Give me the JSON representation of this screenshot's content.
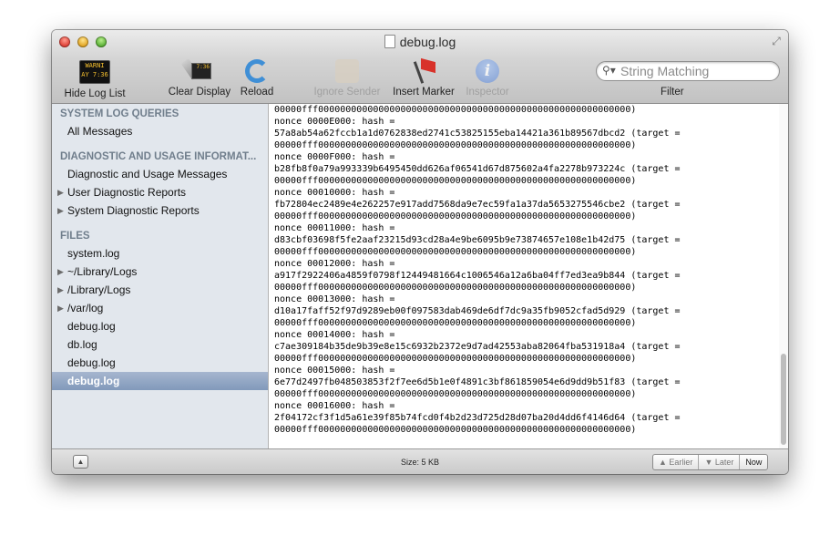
{
  "window": {
    "title": "debug.log"
  },
  "toolbar": {
    "hide_log_list": {
      "label": "Hide Log List",
      "icon": "console-icon",
      "screen_text": "WARNI\nAY 7:36"
    },
    "clear_display": {
      "label": "Clear Display",
      "icon": "clear-display-icon",
      "screen_text": "7:36"
    },
    "reload": {
      "label": "Reload",
      "icon": "reload-icon"
    },
    "ignore_sender": {
      "label": "Ignore Sender",
      "icon": "ignore-sender-icon",
      "enabled": false
    },
    "insert_marker": {
      "label": "Insert Marker",
      "icon": "flag-icon"
    },
    "inspector": {
      "label": "Inspector",
      "icon": "info-icon",
      "glyph": "i",
      "enabled": false
    }
  },
  "search": {
    "placeholder": "String Matching",
    "value": "",
    "label": "Filter"
  },
  "sidebar": {
    "sections": [
      {
        "heading": "SYSTEM LOG QUERIES",
        "items": [
          {
            "label": "All Messages"
          }
        ]
      },
      {
        "heading": "DIAGNOSTIC AND USAGE INFORMAT...",
        "items": [
          {
            "label": "Diagnostic and Usage Messages"
          },
          {
            "label": "User Diagnostic Reports",
            "disclosure": true
          },
          {
            "label": "System Diagnostic Reports",
            "disclosure": true
          }
        ]
      },
      {
        "heading": "FILES",
        "items": [
          {
            "label": "system.log"
          },
          {
            "label": "~/Library/Logs",
            "disclosure": true
          },
          {
            "label": "/Library/Logs",
            "disclosure": true
          },
          {
            "label": "/var/log",
            "disclosure": true
          },
          {
            "label": "debug.log"
          },
          {
            "label": "db.log"
          },
          {
            "label": "debug.log"
          },
          {
            "label": "debug.log",
            "selected": true
          }
        ]
      }
    ]
  },
  "log_text": "00000fff000000000000000000000000000000000000000000000000000000000)\nnonce 0000E000: hash =\n57a8ab54a62fccb1a1d0762838ed2741c53825155eba14421a361b89567dbcd2 (target =\n00000fff000000000000000000000000000000000000000000000000000000000)\nnonce 0000F000: hash =\nb28fb8f0a79a993339b6495450dd626af06541d67d875602a4fa2278b973224c (target =\n00000fff000000000000000000000000000000000000000000000000000000000)\nnonce 00010000: hash =\nfb72804ec2489e4e262257e917add7568da9e7ec59fa1a37da5653275546cbe2 (target =\n00000fff000000000000000000000000000000000000000000000000000000000)\nnonce 00011000: hash =\nd83cbf03698f5fe2aaf23215d93cd28a4e9be6095b9e73874657e108e1b42d75 (target =\n00000fff000000000000000000000000000000000000000000000000000000000)\nnonce 00012000: hash =\na917f2922406a4859f0798f12449481664c1006546a12a6ba04ff7ed3ea9b844 (target =\n00000fff000000000000000000000000000000000000000000000000000000000)\nnonce 00013000: hash =\nd10a17faff52f97d9289eb00f097583dab469de6df7dc9a35fb9052cfad5d929 (target =\n00000fff000000000000000000000000000000000000000000000000000000000)\nnonce 00014000: hash =\nc7ae309184b35de9b39e8e15c6932b2372e9d7ad42553aba82064fba531918a4 (target =\n00000fff000000000000000000000000000000000000000000000000000000000)\nnonce 00015000: hash =\n6e77d2497fb048503853f2f7ee6d5b1e0f4891c3bf861859054e6d9dd9b51f83 (target =\n00000fff000000000000000000000000000000000000000000000000000000000)\nnonce 00016000: hash =\n2f04172cf3f1d5a61e39f85b74fcd0f4b2d23d725d28d07ba20d4dd6f4146d64 (target =\n00000fff000000000000000000000000000000000000000000000000000000000)",
  "status": {
    "size": "Size: 5 KB",
    "earlier": "Earlier",
    "later": "Later",
    "now": "Now"
  }
}
